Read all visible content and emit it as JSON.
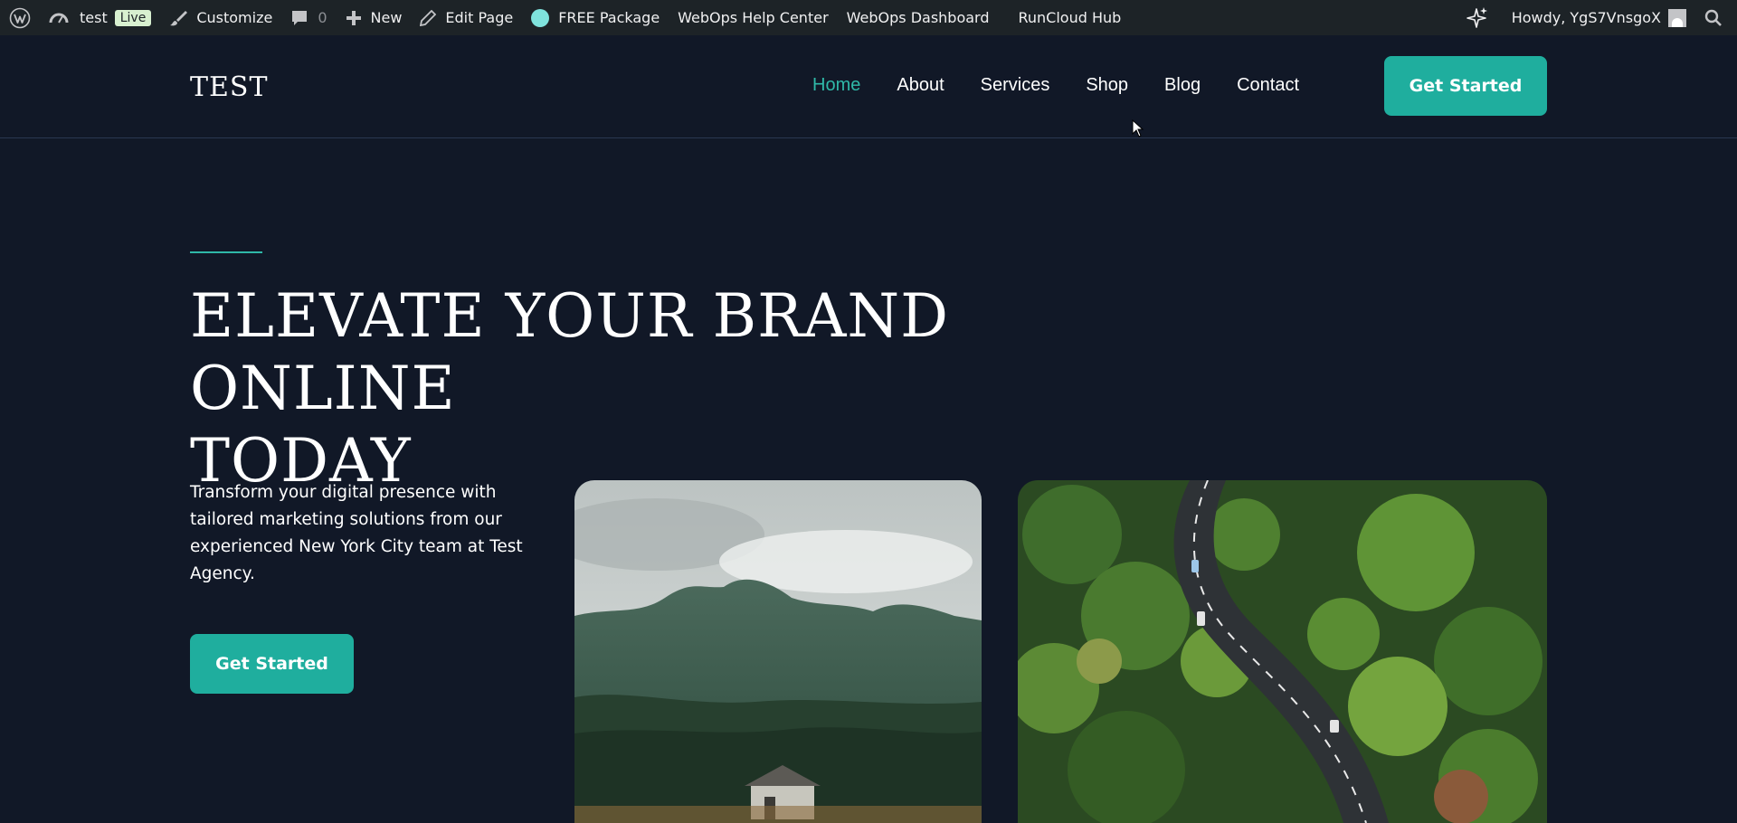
{
  "adminbar": {
    "wp_logo_icon": "wordpress-icon",
    "site_name": "test",
    "live_badge": "Live",
    "customize": "Customize",
    "comments_count": "0",
    "new": "New",
    "edit_page": "Edit Page",
    "free_package": "FREE Package",
    "help_center": "WebOps Help Center",
    "dashboard": "WebOps Dashboard",
    "runcloud_hub": "RunCloud Hub",
    "howdy": "Howdy, YgS7VnsgoX"
  },
  "header": {
    "logo": "TEST",
    "nav": [
      {
        "label": "Home",
        "active": true
      },
      {
        "label": "About"
      },
      {
        "label": "Services"
      },
      {
        "label": "Shop"
      },
      {
        "label": "Blog"
      },
      {
        "label": "Contact"
      }
    ],
    "cta": "Get Started"
  },
  "hero": {
    "title_line1": "ELEVATE YOUR BRAND ONLINE",
    "title_line2": "TODAY",
    "text": "Transform your digital presence with tailored marketing solutions from our experienced New York City team at Test Agency.",
    "cta": "Get Started"
  },
  "colors": {
    "background": "#111827",
    "accent": "#1fae9e",
    "adminbar": "#1d2327"
  }
}
